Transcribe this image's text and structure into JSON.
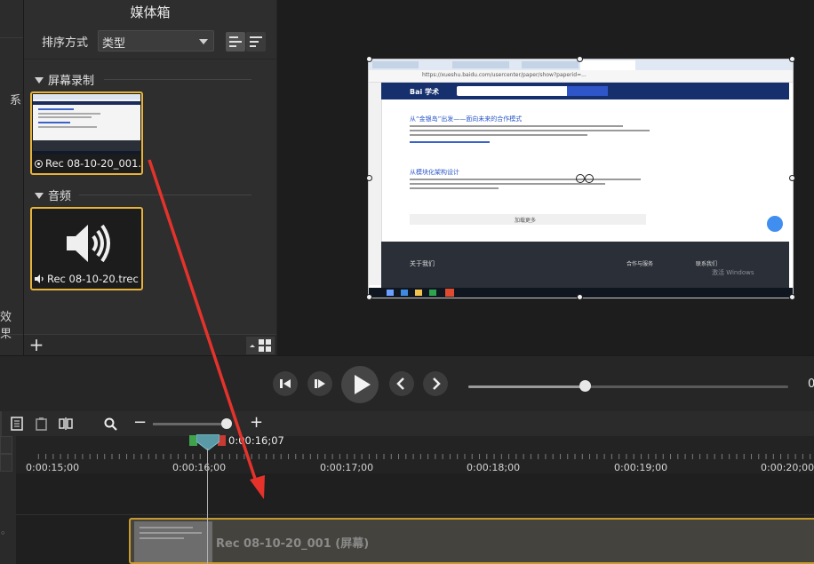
{
  "left_strip": {
    "partial_1": "系",
    "partial_2": "效果"
  },
  "media_bin": {
    "title": "媒体箱",
    "sort_label": "排序方式",
    "sort_value": "类型",
    "sections": [
      {
        "title": "屏幕录制",
        "items": [
          {
            "name": "Rec 08-10-20_001...",
            "type": "screen-recording"
          }
        ]
      },
      {
        "title": "音频",
        "items": [
          {
            "name": "Rec 08-10-20.trec",
            "type": "audio"
          }
        ]
      }
    ]
  },
  "canvas": {
    "browser": {
      "url": "https://xueshu.baidu.com/usercenter/paper/show?paperid=...",
      "site_logo": "Bai 学术",
      "results": [
        {
          "title": "从“金银岛”出发——面向未来的合作模式"
        },
        {
          "title": "从模块化架构设计"
        }
      ],
      "more_button": "加载更多",
      "footer_title": "关于我们",
      "footer_col2": "合作与服务",
      "footer_col3": "联系我们",
      "watermark": "激活 Windows"
    }
  },
  "playback": {
    "time_display": "0"
  },
  "timeline": {
    "playhead_time": "0:00:16;07",
    "ruler_labels": [
      "0:00:15;00",
      "0:00:16;00",
      "0:00:17;00",
      "0:00:18;00",
      "0:00:19;00",
      "0:00:20;00"
    ],
    "clip_label": "Rec 08-10-20_001 (屏幕)"
  },
  "colors": {
    "selection": "#e7b33b",
    "annotation_arrow": "#e5322b"
  }
}
